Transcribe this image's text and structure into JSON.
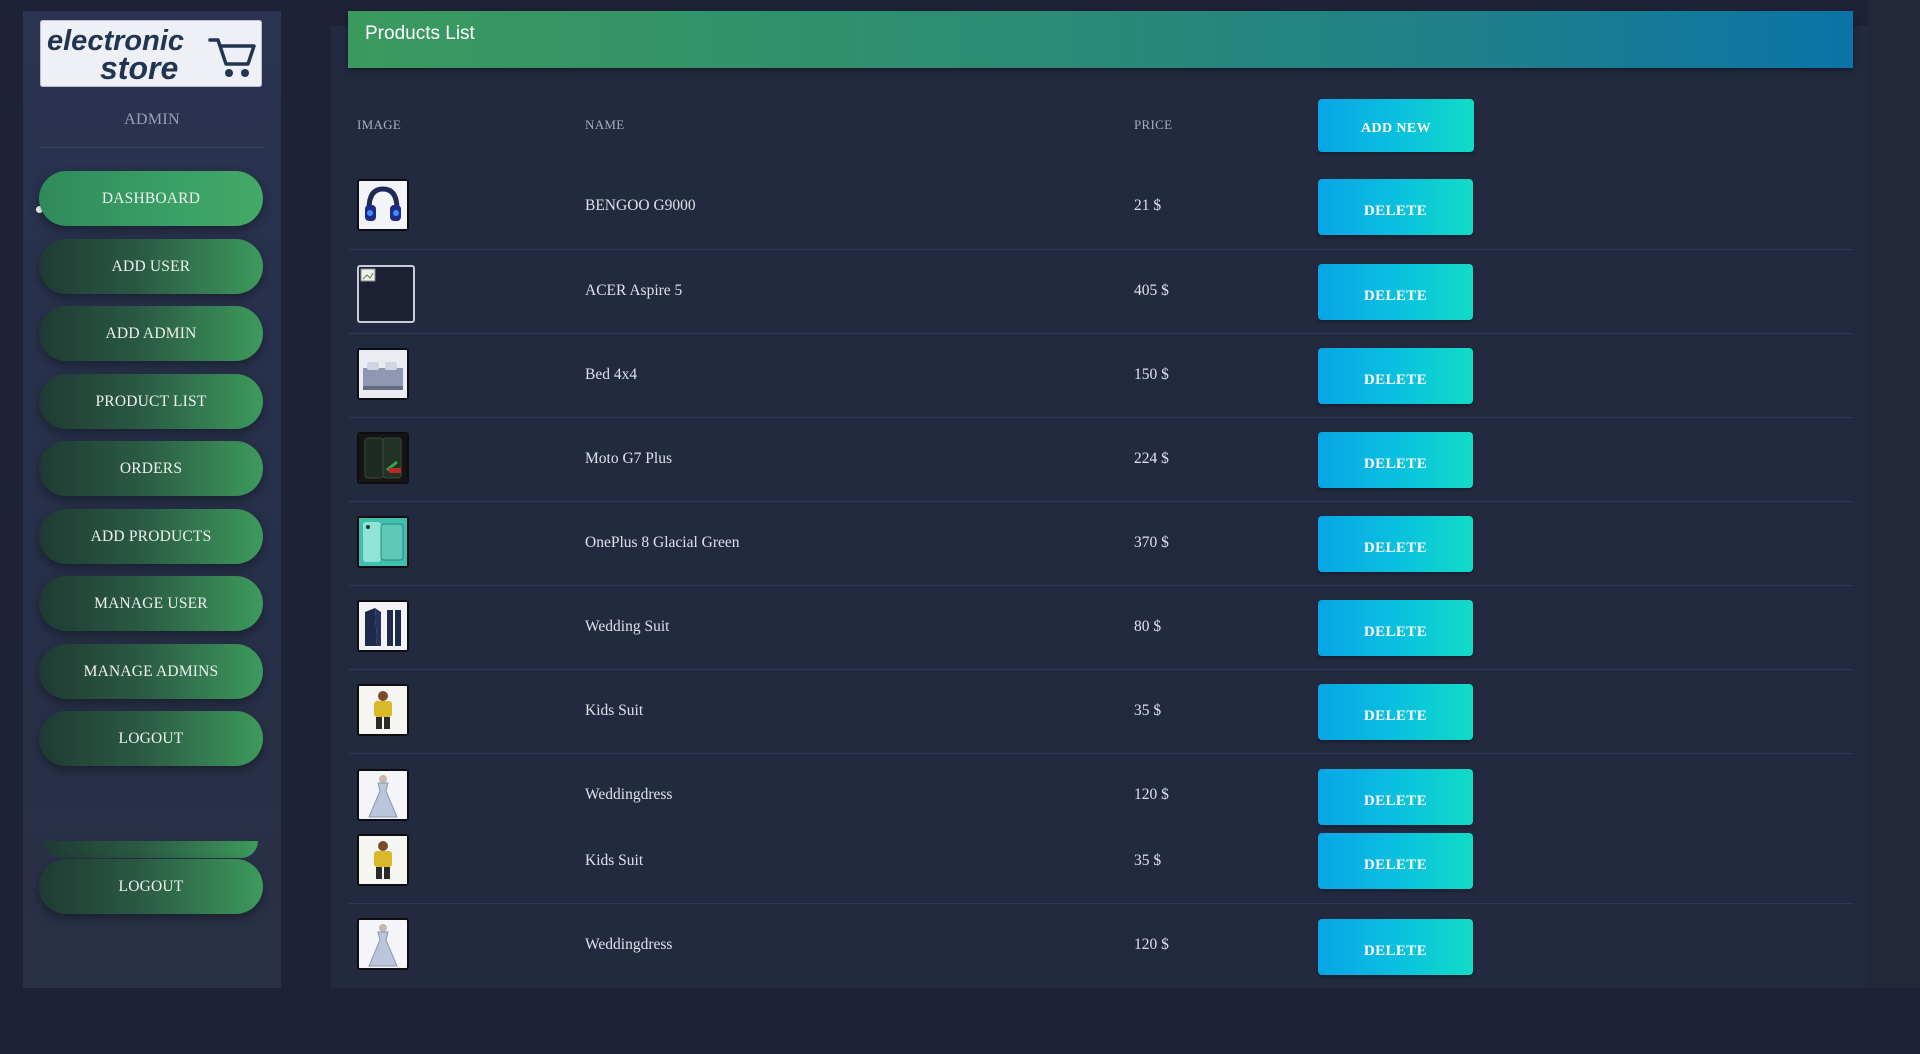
{
  "sidebar": {
    "logo_line1": "electronic",
    "logo_line2": "store",
    "role": "ADMIN",
    "items": [
      {
        "label": "DASHBOARD"
      },
      {
        "label": "ADD USER"
      },
      {
        "label": "ADD ADMIN"
      },
      {
        "label": "PRODUCT LIST"
      },
      {
        "label": "ORDERS"
      },
      {
        "label": "ADD PRODUCTS"
      },
      {
        "label": "MANAGE USER"
      },
      {
        "label": "MANAGE ADMINS"
      },
      {
        "label": "LOGOUT"
      }
    ],
    "extra_logout": "LOGOUT"
  },
  "header": {
    "title": "Products List"
  },
  "table": {
    "columns": [
      "IMAGE",
      "NAME",
      "PRICE"
    ],
    "add_new_label": "ADD NEW",
    "delete_label": "DELETE",
    "rows": [
      {
        "name": "BENGOO G9000",
        "price": "21 $",
        "image_icon": "headset-image"
      },
      {
        "name": "ACER Aspire 5",
        "price": "405 $",
        "image_icon": "broken-image"
      },
      {
        "name": "Bed 4x4",
        "price": "150 $",
        "image_icon": "bed-image"
      },
      {
        "name": "Moto G7 Plus",
        "price": "224 $",
        "image_icon": "phone-image"
      },
      {
        "name": "OnePlus 8 Glacial Green",
        "price": "370 $",
        "image_icon": "phone-green-image"
      },
      {
        "name": "Wedding Suit",
        "price": "80 $",
        "image_icon": "suit-image"
      },
      {
        "name": "Kids Suit",
        "price": "35 $",
        "image_icon": "kids-suit-image"
      },
      {
        "name": "Weddingdress",
        "price": "120 $",
        "image_icon": "dress-image"
      },
      {
        "name": "Kids Suit",
        "price": "35 $",
        "image_icon": "kids-suit-image"
      },
      {
        "name": "Weddingdress",
        "price": "120 $",
        "image_icon": "dress-image"
      }
    ]
  },
  "colors": {
    "accent_green": "#3a9a5e",
    "accent_blue": "#0a74a8",
    "button_cyan": "#0bbfe0",
    "background": "#1e2236"
  }
}
